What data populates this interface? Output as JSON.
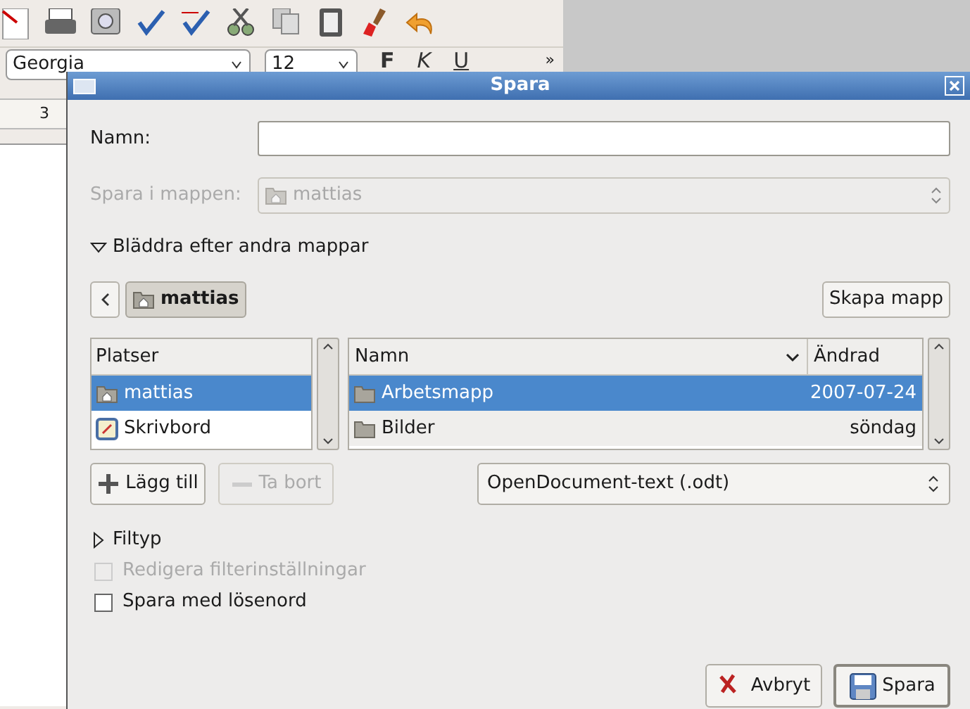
{
  "app": {
    "font_name": "Georgia",
    "font_size": "12",
    "format_buttons": [
      "F",
      "K",
      "U"
    ],
    "overflow": "»",
    "ruler_mark": "3"
  },
  "dialog": {
    "title": "Spara",
    "name_label": "Namn:",
    "location": {
      "label": "Spara i mappen:",
      "value": "mattias",
      "disabled": true
    },
    "browse_expander": {
      "label": "Bläddra efter andra mappar",
      "expanded": true
    },
    "path_bar": {
      "current": "mattias"
    },
    "create_folder": "Skapa mapp",
    "places": {
      "header": "Platser",
      "items": [
        {
          "label": "mattias",
          "kind": "home",
          "selected": true
        },
        {
          "label": "Skrivbord",
          "kind": "desktop",
          "selected": false
        }
      ]
    },
    "files": {
      "columns": [
        "Namn",
        "Ändrad"
      ],
      "rows": [
        {
          "name": "Arbetsmapp",
          "modified": "2007-07-24",
          "selected": true
        },
        {
          "name": "Bilder",
          "modified": "söndag",
          "selected": false
        }
      ]
    },
    "place_buttons": [
      {
        "label": "Lägg till",
        "kind": "add",
        "disabled": false
      },
      {
        "label": "Ta bort",
        "kind": "remove",
        "disabled": true
      }
    ],
    "filter": "OpenDocument-text (.odt)",
    "filetype_expander": {
      "label": "Filtyp",
      "expanded": false
    },
    "options": [
      {
        "label": "Redigera filterinställningar",
        "checked": false,
        "disabled": true
      },
      {
        "label": "Spara med lösenord",
        "checked": false,
        "disabled": false
      }
    ],
    "buttons": [
      {
        "label": "Avbryt",
        "kind": "cancel"
      },
      {
        "label": "Spara",
        "kind": "save"
      }
    ]
  }
}
